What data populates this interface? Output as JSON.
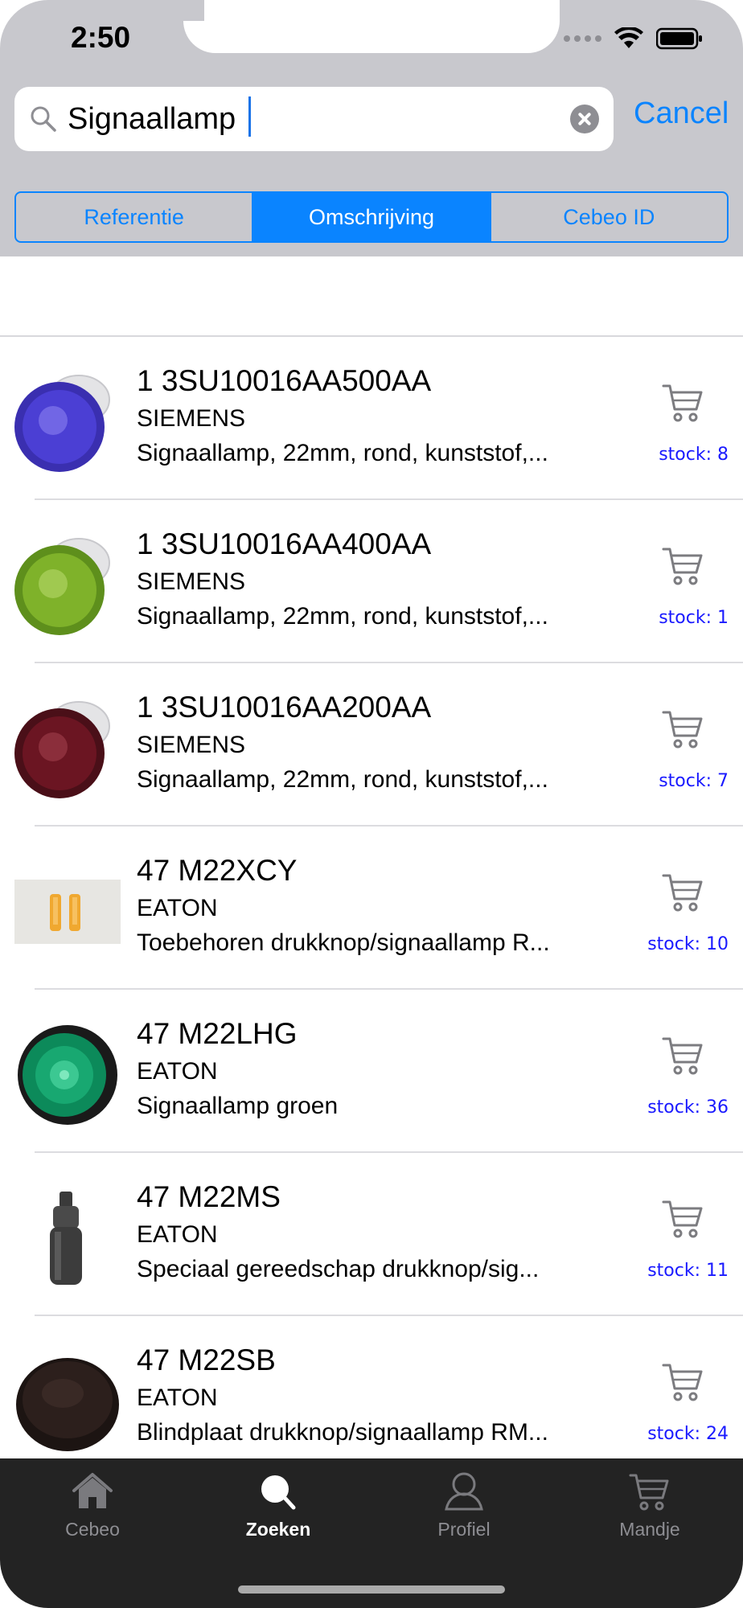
{
  "status_bar": {
    "time": "2:50"
  },
  "search": {
    "value": "Signaallamp",
    "cancel_label": "Cancel"
  },
  "segments": [
    {
      "label": "Referentie",
      "active": false
    },
    {
      "label": "Omschrijving",
      "active": true
    },
    {
      "label": "Cebeo ID",
      "active": false
    }
  ],
  "results": [
    {
      "ref": "1 3SU10016AA500AA",
      "brand": "SIEMENS",
      "desc": "Signaallamp, 22mm, rond, kunststof,...",
      "stock": "stock: 8",
      "thumb": "blue-pilot-lamp"
    },
    {
      "ref": "1 3SU10016AA400AA",
      "brand": "SIEMENS",
      "desc": "Signaallamp, 22mm, rond, kunststof,...",
      "stock": "stock: 1",
      "thumb": "green-pilot-lamp"
    },
    {
      "ref": "1 3SU10016AA200AA",
      "brand": "SIEMENS",
      "desc": "Signaallamp, 22mm, rond, kunststof,...",
      "stock": "stock: 7",
      "thumb": "red-pilot-lamp"
    },
    {
      "ref": "47 M22XCY",
      "brand": "EATON",
      "desc": "Toebehoren drukknop/signaallamp R...",
      "stock": "stock: 10",
      "thumb": "yellow-caps"
    },
    {
      "ref": "47 M22LHG",
      "brand": "EATON",
      "desc": "Signaallamp groen",
      "stock": "stock: 36",
      "thumb": "green-lens"
    },
    {
      "ref": "47 M22MS",
      "brand": "EATON",
      "desc": "Speciaal gereedschap drukknop/sig...",
      "stock": "stock: 11",
      "thumb": "tool"
    },
    {
      "ref": "47 M22SB",
      "brand": "EATON",
      "desc": "Blindplaat drukknop/signaallamp RM...",
      "stock": "stock: 24",
      "thumb": "blind-plate"
    }
  ],
  "tabs": [
    {
      "label": "Cebeo",
      "icon": "home-icon",
      "active": false
    },
    {
      "label": "Zoeken",
      "icon": "search-icon",
      "active": true
    },
    {
      "label": "Profiel",
      "icon": "profile-icon",
      "active": false
    },
    {
      "label": "Mandje",
      "icon": "cart-icon",
      "active": false
    }
  ],
  "colors": {
    "accent": "#0a84ff",
    "stock_text": "#1a1aff",
    "header_bg": "#c8c8cd",
    "tabbar_bg": "#232323"
  }
}
